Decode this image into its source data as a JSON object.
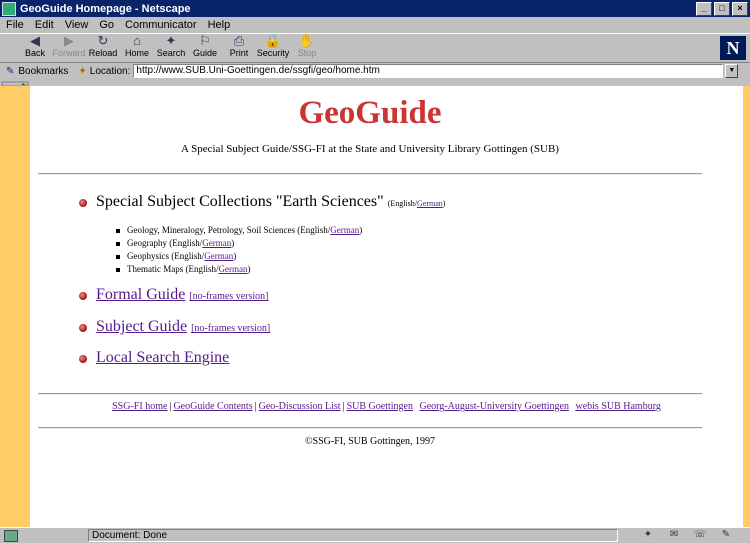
{
  "window": {
    "title": "GeoGuide Homepage - Netscape",
    "min": "_",
    "max": "□",
    "close": "×"
  },
  "menu": [
    "File",
    "Edit",
    "View",
    "Go",
    "Communicator",
    "Help"
  ],
  "toolbar": [
    {
      "label": "Back",
      "icon": "back-arrow-icon",
      "glyph": "◀",
      "disabled": false
    },
    {
      "label": "Forward",
      "icon": "forward-arrow-icon",
      "glyph": "▶",
      "disabled": true
    },
    {
      "label": "Reload",
      "icon": "reload-icon",
      "glyph": "↻",
      "disabled": false
    },
    {
      "label": "Home",
      "icon": "home-icon",
      "glyph": "⌂",
      "disabled": false
    },
    {
      "label": "Search",
      "icon": "search-icon",
      "glyph": "✦",
      "disabled": false
    },
    {
      "label": "Guide",
      "icon": "guide-icon",
      "glyph": "⚐",
      "disabled": false
    },
    {
      "label": "Print",
      "icon": "print-icon",
      "glyph": "⎙",
      "disabled": false
    },
    {
      "label": "Security",
      "icon": "security-icon",
      "glyph": "🔒",
      "disabled": false
    },
    {
      "label": "Stop",
      "icon": "stop-icon",
      "glyph": "✋",
      "disabled": true
    }
  ],
  "brand": "N",
  "location": {
    "bookmarks_label": "Bookmarks",
    "location_label": "Location:",
    "url": "http://www.SUB.Uni-Goettingen.de/ssgfi/geo/home.htm"
  },
  "page": {
    "title": "GeoGuide",
    "subtitle": "A Special Subject Guide/SSG-FI at the State and University Library Gottingen (SUB)",
    "collections": {
      "title": "Special Subject Collections \"Earth Sciences\"",
      "lang_prefix": "(English/",
      "lang_link": "German",
      "lang_suffix": ")",
      "items": [
        {
          "text": "Geology, Mineralogy, Petrology, Soil Sciences (English/",
          "link": "German",
          "end": ")"
        },
        {
          "text": "Geography (English/",
          "link": "German",
          "end": ")"
        },
        {
          "text": "Geophysics (English/",
          "link": "German",
          "end": ")"
        },
        {
          "text": "Thematic Maps (English/",
          "link": "German",
          "end": ")"
        }
      ]
    },
    "formal_guide": {
      "label": "Formal Guide",
      "alt": "[no-frames version]"
    },
    "subject_guide": {
      "label": "Subject Guide",
      "alt": "[no-frames version]"
    },
    "local_search": "Local Search Engine",
    "footer_links": [
      "SSG-FI home",
      "GeoGuide Contents",
      "Geo-Discussion List",
      "SUB Goettingen",
      "Georg-August-University Goettingen",
      "webis SUB Hamburg"
    ],
    "copyright": "©SSG-FI, SUB Gottingen, 1997"
  },
  "status": {
    "text": "Document: Done"
  },
  "colors": {
    "title_red": "#cc3333",
    "link_purple": "#551a8b",
    "frame_orange": "#ffcc66"
  }
}
